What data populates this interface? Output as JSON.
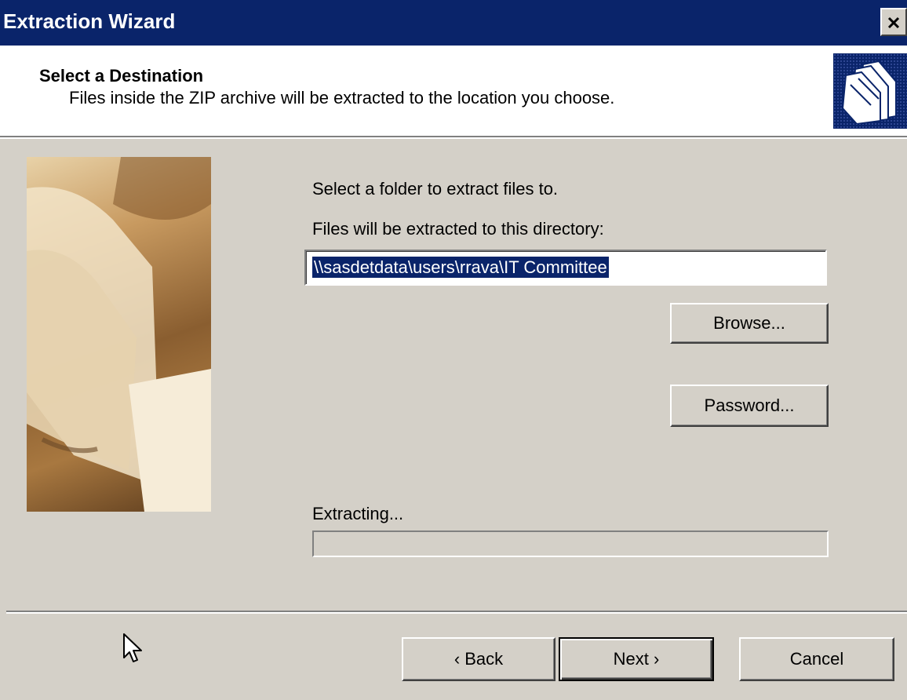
{
  "window": {
    "title": "Extraction Wizard",
    "close_symbol": "✕"
  },
  "header": {
    "title": "Select a Destination",
    "subtitle": "Files inside the ZIP archive will be extracted to the location you choose.",
    "icon": "folders-icon"
  },
  "main": {
    "instruction": "Select a folder to extract files to.",
    "directory_label": "Files will be extracted to this directory:",
    "directory_value": "\\\\sasdetdata\\users\\rrava\\IT Committee",
    "browse_label": "Browse...",
    "password_label": "Password...",
    "progress_label": "Extracting...",
    "progress_percent": 0
  },
  "footer": {
    "back_label": "‹ Back",
    "next_label": "Next ›",
    "cancel_label": "Cancel"
  },
  "colors": {
    "titlebar": "#0a246a",
    "face": "#d4d0c8",
    "selection": "#0a246a"
  }
}
